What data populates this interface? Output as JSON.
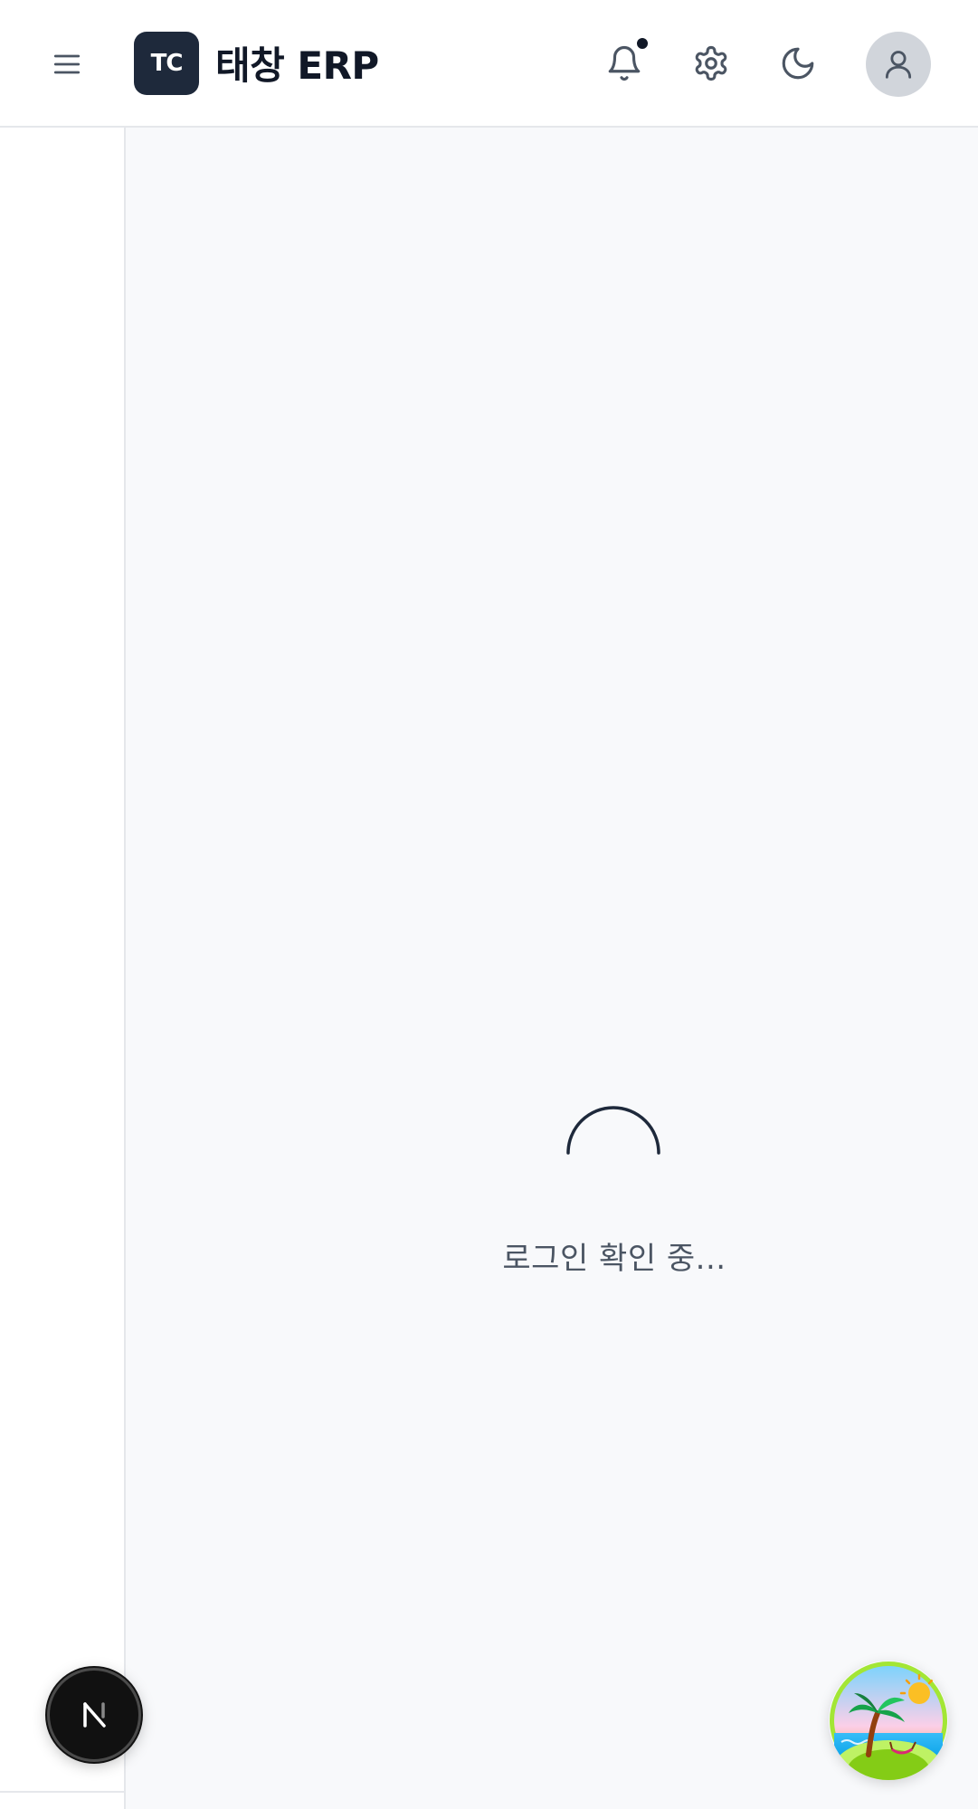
{
  "header": {
    "logo_text": "TC",
    "app_title": "태창 ERP",
    "notification_indicator": true
  },
  "main": {
    "loading_text": "로그인 확인 중..."
  },
  "icons": {
    "menu": "hamburger-menu-icon",
    "bell": "bell-icon",
    "gear": "gear-icon",
    "moon": "moon-icon",
    "user": "user-icon",
    "next": "nextjs-logo-icon",
    "island": "palm-island-icon"
  },
  "colors": {
    "logo_bg": "#1e293b",
    "title_text": "#111827",
    "main_bg": "#f8f9fb",
    "loading_text": "#4b5563",
    "avatar_bg": "#d1d5db",
    "border": "#e5e7eb"
  }
}
